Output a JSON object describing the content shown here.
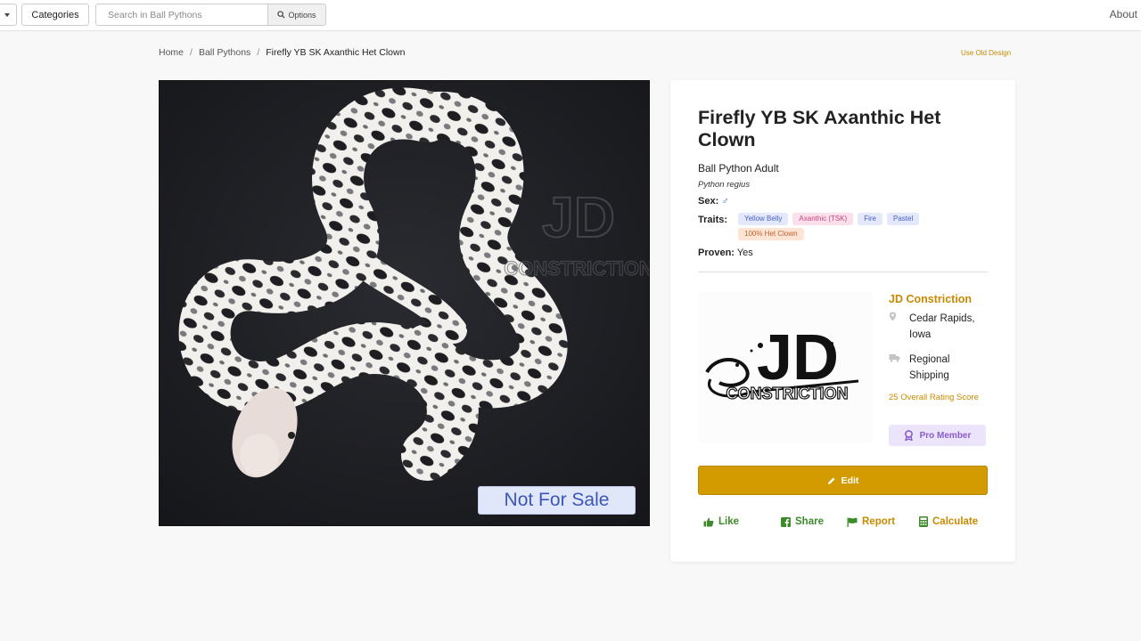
{
  "topbar": {
    "categories_label": "Categories",
    "search_placeholder": "Search in Ball Pythons",
    "options_label": "Options",
    "about_label": "About"
  },
  "breadcrumb": {
    "items": [
      "Home",
      "Ball Pythons",
      "Firefly YB SK Axanthic Het Clown"
    ]
  },
  "use_old_design": "Use Old Design",
  "photo": {
    "watermark": "JD CONSTRICTION",
    "sale_badge": "Not For Sale"
  },
  "listing": {
    "title": "Firefly YB SK Axanthic Het Clown",
    "subtitle": "Ball Python Adult",
    "latin": "Python regius",
    "sex_label": "Sex:",
    "sex_value": "♂",
    "traits_label": "Traits:",
    "traits": [
      {
        "label": "Yellow Belly",
        "bg": "#e3e8fb",
        "fg": "#4a5fc0"
      },
      {
        "label": "Axanthic (TSK)",
        "bg": "#fbe0ec",
        "fg": "#c0467c"
      },
      {
        "label": "Fire",
        "bg": "#e3e8fb",
        "fg": "#4a5fc0"
      },
      {
        "label": "Pastel",
        "bg": "#e3e8fb",
        "fg": "#4a5fc0"
      },
      {
        "label": "100% Het Clown",
        "bg": "#fde4d4",
        "fg": "#c0622a"
      }
    ],
    "proven_label": "Proven:",
    "proven_value": "Yes"
  },
  "seller": {
    "name": "JD Constriction",
    "logo_text_top": "JD",
    "logo_text_bottom": "CONSTRICTION",
    "location": "Cedar Rapids, Iowa",
    "shipping": "Regional Shipping",
    "rating": "25 Overall Rating Score",
    "badge": "Pro Member"
  },
  "actions": {
    "edit": "Edit",
    "like": "Like",
    "share": "Share",
    "report": "Report",
    "calculate": "Calculate"
  },
  "colors": {
    "accent": "#d49b00",
    "green": "#3d8a2a",
    "pro": "#8a5cc9"
  }
}
